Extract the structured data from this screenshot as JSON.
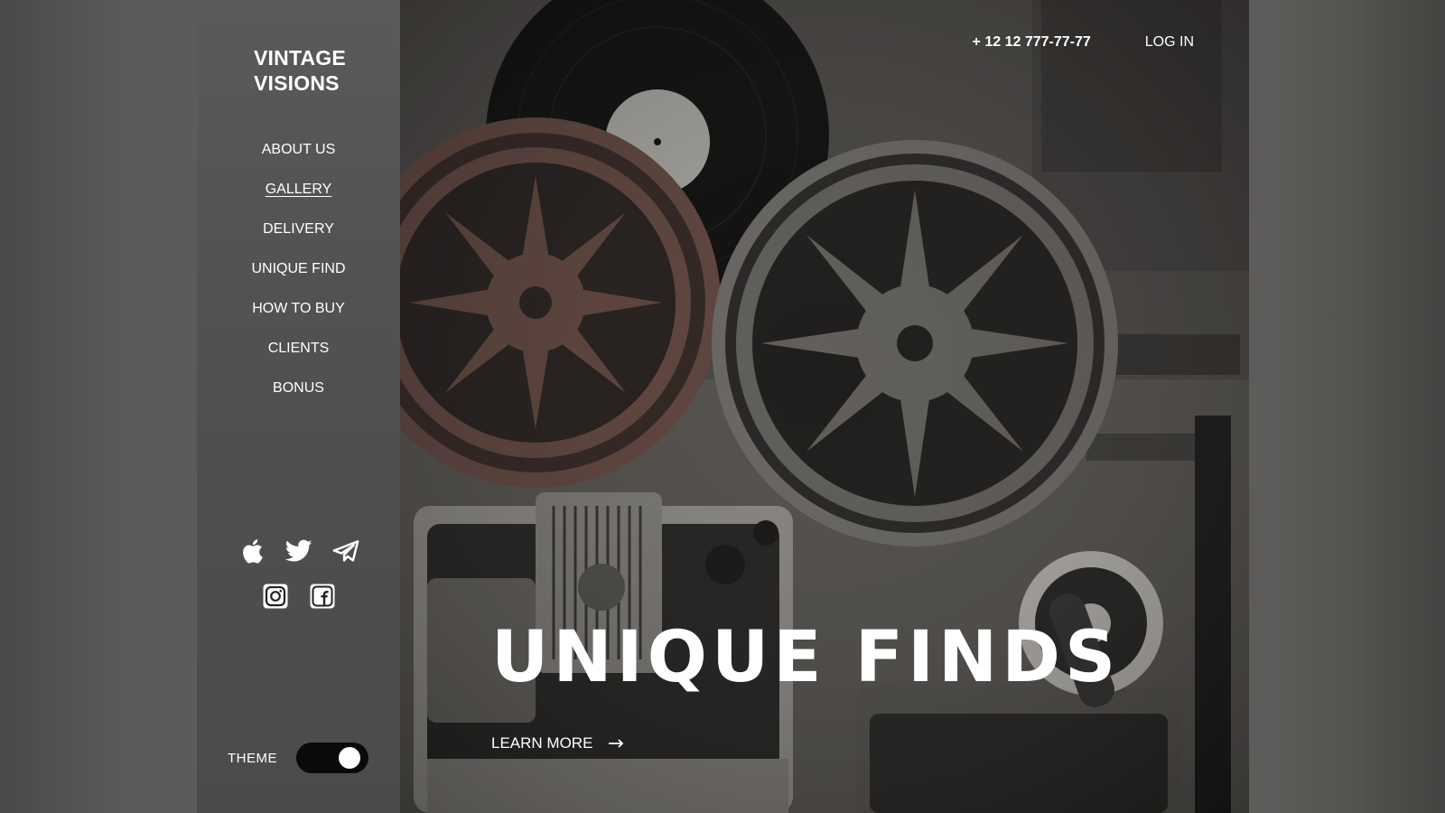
{
  "sidebar": {
    "logo": {
      "line1": "VINTAGE",
      "line2": "VISIONS"
    },
    "nav": [
      {
        "label": "ABOUT US",
        "active": false
      },
      {
        "label": "GALLERY",
        "active": true
      },
      {
        "label": "DELIVERY",
        "active": false
      },
      {
        "label": "UNIQUE FIND",
        "active": false
      },
      {
        "label": "HOW TO BUY",
        "active": false
      },
      {
        "label": "CLIENTS",
        "active": false
      },
      {
        "label": "BONUS",
        "active": false
      }
    ],
    "social_icons": [
      "apple-icon",
      "twitter-icon",
      "telegram-icon",
      "instagram-icon",
      "facebook-icon"
    ],
    "theme": {
      "label": "THEME",
      "dark_mode_on": true
    }
  },
  "header": {
    "phone": "+ 12 12 777-77-77",
    "login": "LOG IN"
  },
  "hero": {
    "headline": "UNIQUE FINDS",
    "cta": "LEARN MORE",
    "image": "vintage-film-reels-projector-photo"
  },
  "colors": {
    "sidebar_bg": "#555452",
    "text": "#ffffff",
    "toggle_bg": "#0a0a0a"
  }
}
